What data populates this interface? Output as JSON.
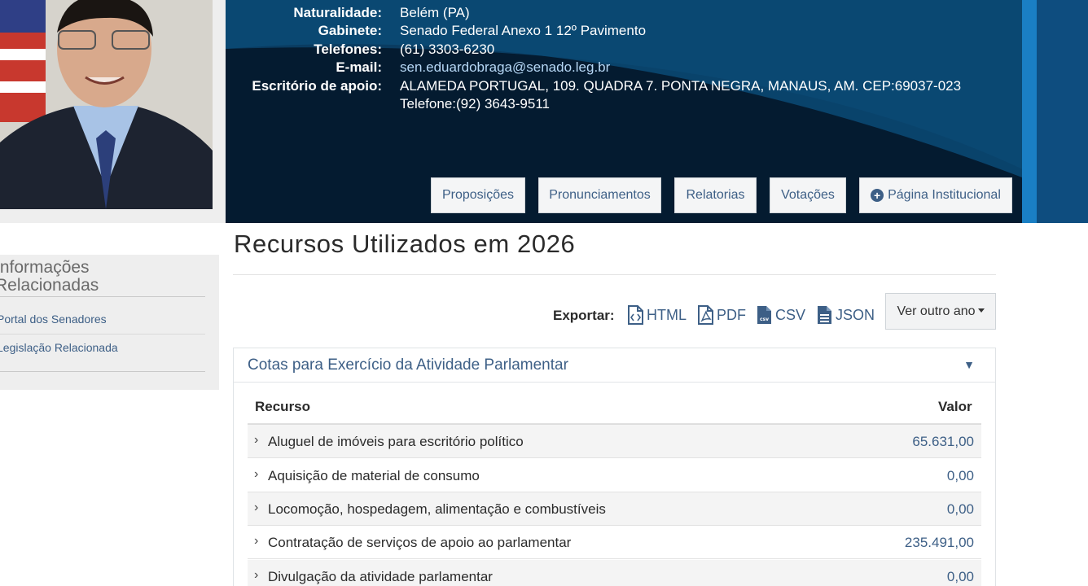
{
  "senator_info": {
    "rows": [
      {
        "label": "Naturalidade:",
        "value": "Belém (PA)"
      },
      {
        "label": "Gabinete:",
        "value": "Senado Federal Anexo 1 12º Pavimento"
      },
      {
        "label": "Telefones:",
        "value": "(61) 3303-6230"
      },
      {
        "label": "E-mail:",
        "value": "sen.eduardobraga@senado.leg.br"
      },
      {
        "label": "Escritório de apoio:",
        "value": "ALAMEDA PORTUGAL, 109. QUADRA 7. PONTA NEGRA, MANAUS, AM. CEP:69037-023"
      }
    ],
    "office_phone": "Telefone:(92) 3643-9511"
  },
  "nav": {
    "proposicoes": "Proposições",
    "pronunciamentos": "Pronunciamentos",
    "relatorias": "Relatorias",
    "votacoes": "Votações",
    "pagina_institucional": "Página Institucional"
  },
  "sidebar": {
    "title_line1": "Informações",
    "title_line2": "Relacionadas",
    "links": [
      "Portal dos Senadores",
      "Legislação Relacionada"
    ]
  },
  "main": {
    "title": "Recursos Utilizados em 2026",
    "export_label": "Exportar:",
    "export_formats": [
      "HTML",
      "PDF",
      "CSV",
      "JSON"
    ],
    "year_button": "Ver outro ano",
    "panel_title": "Cotas para Exercício da Atividade Parlamentar",
    "table": {
      "headers": [
        "Recurso",
        "Valor"
      ],
      "rows": [
        {
          "label": "Aluguel de imóveis para escritório político",
          "value": "65.631,00"
        },
        {
          "label": "Aquisição de material de consumo",
          "value": "0,00"
        },
        {
          "label": "Locomoção, hospedagem, alimentação e combustíveis",
          "value": "0,00"
        },
        {
          "label": "Contratação de serviços de apoio ao parlamentar",
          "value": "235.491,00"
        },
        {
          "label": "Divulgação da atividade parlamentar",
          "value": "0,00"
        }
      ]
    }
  },
  "colors": {
    "banner_bg": "#062a44",
    "accent_blue": "#3d5f86",
    "edge_stripe": "#1a7fc4"
  }
}
